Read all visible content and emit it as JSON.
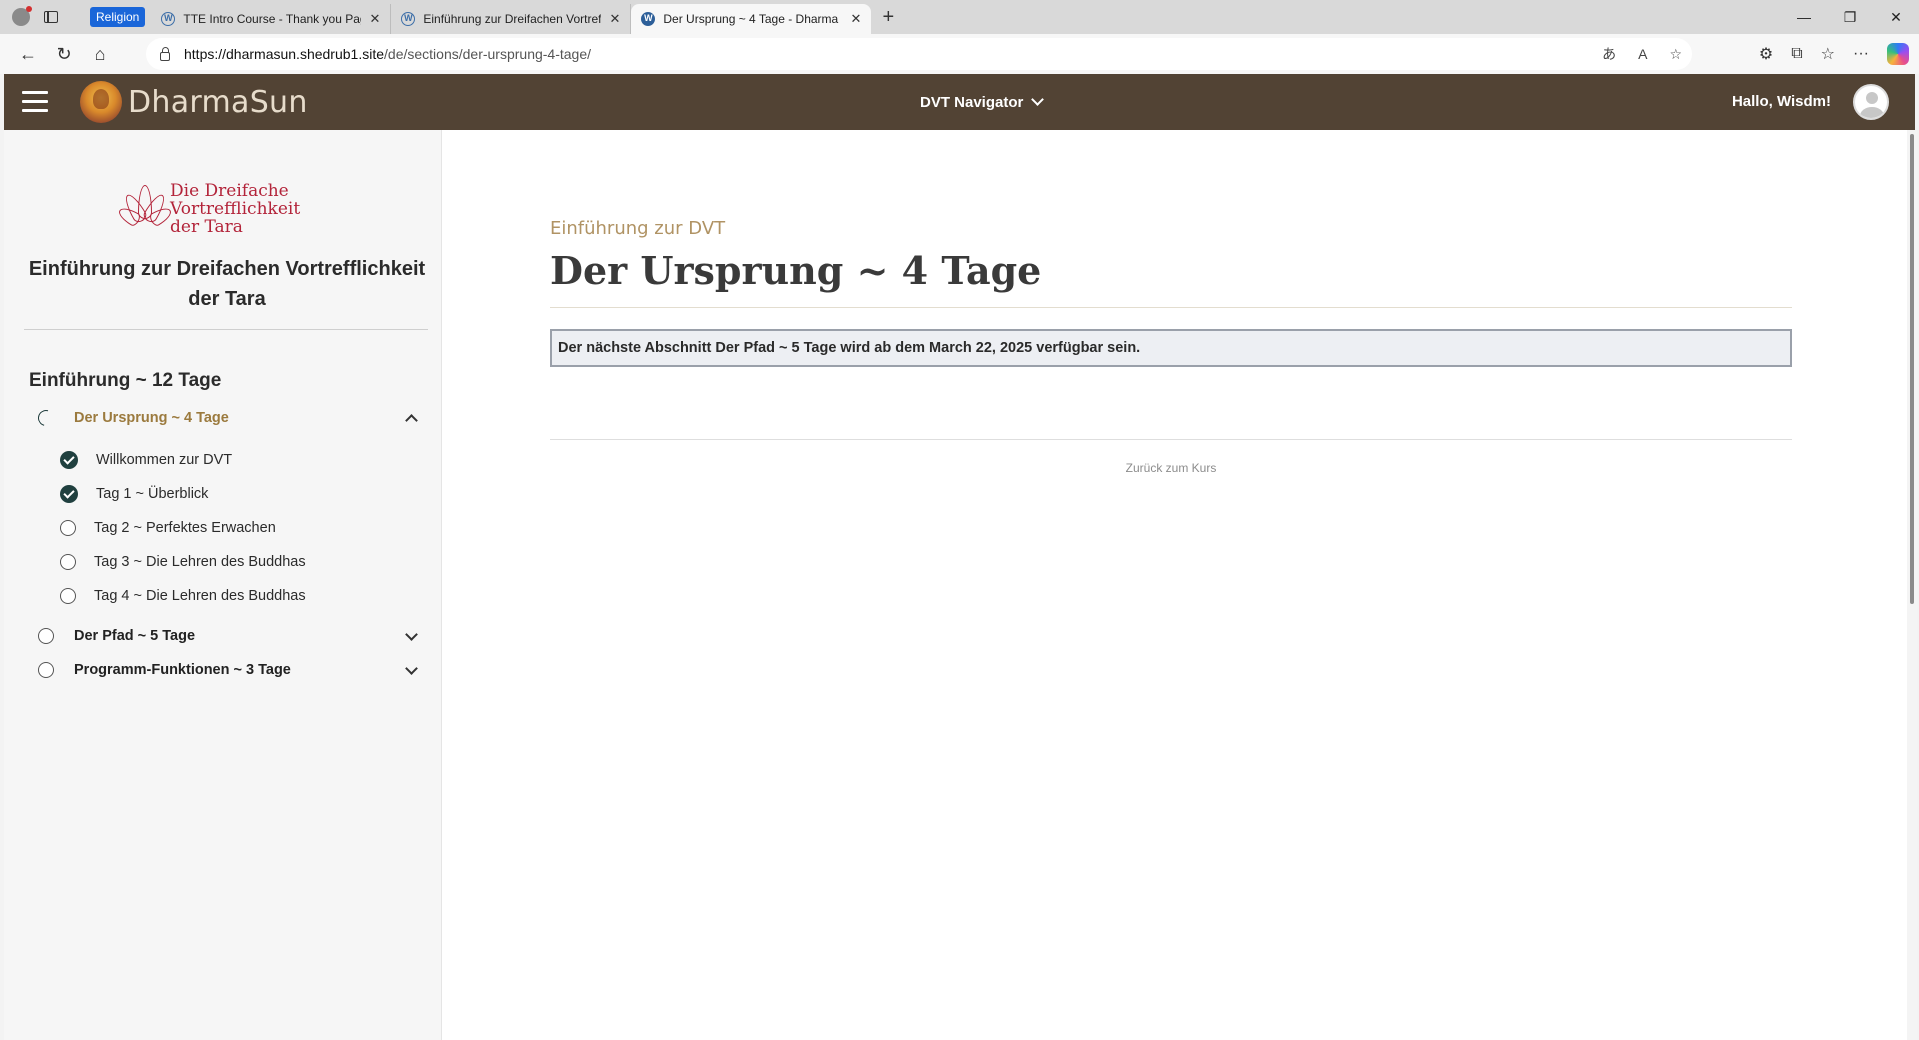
{
  "browser": {
    "tab_group": "Religion",
    "tabs": [
      {
        "title": "TTE Intro Course - Thank you Pag",
        "active": false
      },
      {
        "title": "Einführung zur Dreifachen Vortref",
        "active": false
      },
      {
        "title": "Der Ursprung ~ 4 Tage - Dharma",
        "active": true
      }
    ],
    "url_host": "https://dharmasun.shedrub1.site",
    "url_path": "/de/sections/der-ursprung-4-tage/"
  },
  "header": {
    "brand": "DharmaSun",
    "nav_label": "DVT Navigator",
    "greeting": "Hallo, Wisdm!"
  },
  "sidebar": {
    "logo_lines": [
      "Die Dreifache",
      "Vortrefflichkeit",
      "der Tara"
    ],
    "course_title": "Einführung zur Dreifachen Vortrefflichkeit der Tara",
    "module_title": "Einführung ~ 12 Tage",
    "sections": [
      {
        "label": "Der Ursprung ~ 4 Tage",
        "status": "in-progress",
        "expanded": true
      },
      {
        "label": "Der Pfad ~ 5 Tage",
        "status": "not-started",
        "expanded": false
      },
      {
        "label": "Programm-Funktionen ~ 3 Tage",
        "status": "not-started",
        "expanded": false
      }
    ],
    "lessons": [
      {
        "label": "Willkommen zur DVT",
        "completed": true
      },
      {
        "label": "Tag 1 ~ Überblick",
        "completed": true
      },
      {
        "label": "Tag 2 ~ Perfektes Erwachen",
        "completed": false
      },
      {
        "label": "Tag 3 ~ Die Lehren des Buddhas",
        "completed": false
      },
      {
        "label": "Tag 4 ~ Die Lehren des Buddhas",
        "completed": false
      }
    ]
  },
  "main": {
    "course_link": "Einführung zur DVT",
    "title": "Der Ursprung ~ 4 Tage",
    "notice": "Der nächste Abschnitt Der Pfad ~ 5 Tage wird ab dem March 22, 2025 verfügbar sein.",
    "back_link": "Zurück zum Kurs"
  },
  "colors": {
    "header_bg": "#524334",
    "accent_gold": "#9b7a3e",
    "logo_red": "#b3243a",
    "check_dark": "#20403f"
  }
}
